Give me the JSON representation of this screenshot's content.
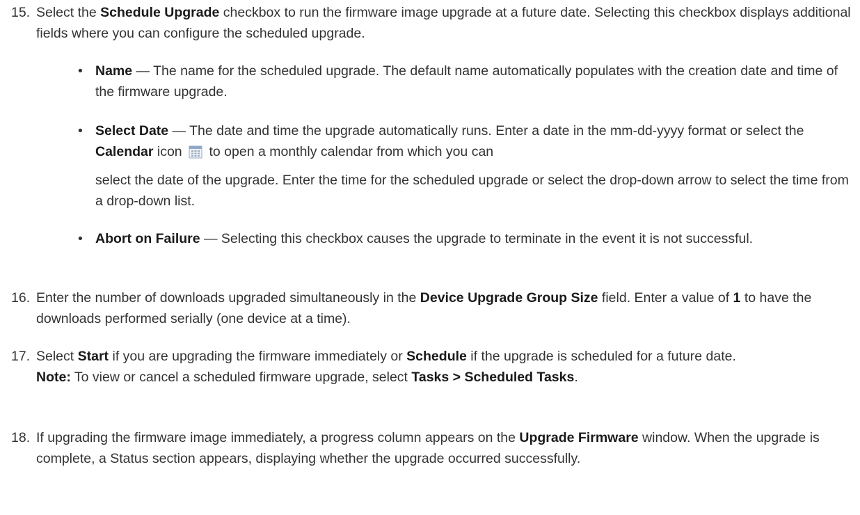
{
  "steps": [
    {
      "number": "15.",
      "parts": [
        "Select the ",
        "Schedule Upgrade",
        " checkbox to run the firmware image upgrade at a future date. Selecting this checkbox displays additional fields where you can configure the scheduled upgrade."
      ],
      "bullets": [
        {
          "term": "Name",
          "text": " — The name for the scheduled upgrade. The default name automatically populates with the creation date and time of the firmware upgrade."
        },
        {
          "term": "Select Date",
          "text_a": " — The date and time the upgrade automatically runs. Enter a date in the mm-dd-yyyy format or select the ",
          "term2": "Calendar",
          "text_b": " icon",
          "icon": "calendar-icon",
          "text_c": " to open a monthly calendar from which you can",
          "text_d": "select the date of the upgrade. Enter the time for the scheduled upgrade or select the drop-down arrow to select the time from a drop-down list."
        },
        {
          "term": "Abort on Failure",
          "text": " — Selecting this checkbox causes the upgrade to terminate in the event it is not successful."
        }
      ]
    },
    {
      "number": "16.",
      "parts": [
        "Enter the number of downloads upgraded simultaneously in the ",
        "Device Upgrade Group Size",
        " field. Enter a value of ",
        "1",
        " to have the downloads performed serially (one device at a time)."
      ]
    },
    {
      "number": "17.",
      "parts": [
        "Select ",
        "Start",
        " if you are upgrading the firmware immediately or ",
        "Schedule",
        " if the upgrade is scheduled for a future date."
      ],
      "note": {
        "label": "Note:",
        "text": " To view or cancel a scheduled firmware upgrade, select ",
        "path": "Tasks > Scheduled Tasks",
        "end": "."
      }
    },
    {
      "number": "18.",
      "parts": [
        "If upgrading the firmware image immediately, a progress column appears on the ",
        "Upgrade Firmware",
        " window. When the upgrade is complete, a Status section appears, displaying whether the upgrade occurred successfully."
      ]
    }
  ],
  "colors": {
    "text": "#333333",
    "bold": "#1a1a1a",
    "icon_accent": "#8fa8c8"
  }
}
